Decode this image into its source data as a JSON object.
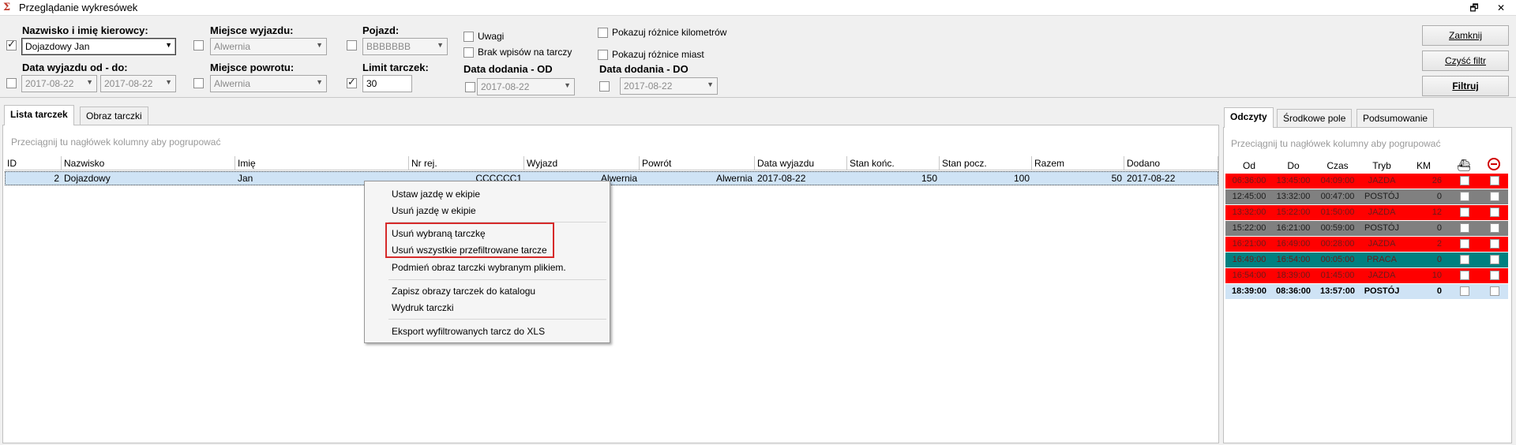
{
  "window": {
    "title": "Przeglądanie wykresówek",
    "app_icon_glyph": "Σ",
    "restore_glyph": "🗗",
    "close_glyph": "✕"
  },
  "filters": {
    "driver_label": "Nazwisko i imię kierowcy:",
    "driver_value": "Dojazdowy Jan",
    "departure_place_label": "Miejsce wyjazdu:",
    "departure_place_value": "Alwernia",
    "vehicle_label": "Pojazd:",
    "vehicle_value": "BBBBBBB",
    "remarks_label": "Uwagi",
    "no_entries_label": "Brak wpisów na tarczy",
    "show_km_diff_label": "Pokazuj różnice kilometrów",
    "show_city_diff_label": "Pokazuj różnice miast",
    "departure_date_label": "Data wyjazdu od - do:",
    "date_from": "2017-08-22",
    "date_to": "2017-08-22",
    "return_place_label": "Miejsce powrotu:",
    "return_place_value": "Alwernia",
    "limit_label": "Limit tarczek:",
    "limit_value": "30",
    "added_from_label": "Data dodania - OD",
    "added_from_value": "2017-08-22",
    "added_to_label": "Data dodania - DO",
    "added_to_value": "2017-08-22"
  },
  "buttons": {
    "close": "Zamknij",
    "clear_filter": "Czyść filtr",
    "filter": "Filtruj"
  },
  "left_tabs": [
    "Lista tarczek",
    "Obraz tarczki"
  ],
  "group_hint": "Przeciągnij tu nagłówek kolumny aby pogrupować",
  "grid": {
    "columns": [
      "ID",
      "Nazwisko",
      "Imię",
      "Nr rej.",
      "Wyjazd",
      "Powrót",
      "Data wyjazdu",
      "Stan końc.",
      "Stan pocz.",
      "Razem",
      "Dodano"
    ],
    "rows": [
      [
        "2",
        "Dojazdowy",
        "Jan",
        "CCCCCC1",
        "Alwernia",
        "Alwernia",
        "2017-08-22",
        "150",
        "100",
        "50",
        "2017-08-22"
      ]
    ]
  },
  "context_menu": {
    "items": [
      "Ustaw jazdę w ekipie",
      "Usuń jazdę w ekipie",
      "Usuń wybraną tarczkę",
      "Usuń wszystkie przefiltrowane tarcze",
      "Podmień obraz tarczki wybranym plikiem.",
      "Zapisz obrazy tarczek do katalogu",
      "Wydruk tarczki",
      "Eksport wyfiltrowanych tarcz do XLS"
    ]
  },
  "right_tabs": [
    "Odczyty",
    "Środkowe pole",
    "Podsumowanie"
  ],
  "readings": {
    "columns": [
      "Od",
      "Do",
      "Czas",
      "Tryb",
      "KM"
    ],
    "icons": [
      "ship-icon",
      "no-entry-icon"
    ],
    "colors": {
      "red": "#ff0000",
      "gray": "#808080",
      "teal": "#008080",
      "summary": "#cfe3f5"
    },
    "rows": [
      {
        "od": "06:36:00",
        "do": "13:45:00",
        "czas": "04:09:00",
        "tryb": "JAZDA",
        "km": "26",
        "color": "red"
      },
      {
        "od": "12:45:00",
        "do": "13:32:00",
        "czas": "00:47:00",
        "tryb": "POSTÓJ",
        "km": "0",
        "color": "gray"
      },
      {
        "od": "13:32:00",
        "do": "15:22:00",
        "czas": "01:50:00",
        "tryb": "JAZDA",
        "km": "12",
        "color": "red"
      },
      {
        "od": "15:22:00",
        "do": "16:21:00",
        "czas": "00:59:00",
        "tryb": "POSTÓJ",
        "km": "0",
        "color": "gray"
      },
      {
        "od": "16:21:00",
        "do": "16:49:00",
        "czas": "00:28:00",
        "tryb": "JAZDA",
        "km": "2",
        "color": "red"
      },
      {
        "od": "16:49:00",
        "do": "16:54:00",
        "czas": "00:05:00",
        "tryb": "PRACA",
        "km": "0",
        "color": "teal"
      },
      {
        "od": "16:54:00",
        "do": "18:39:00",
        "czas": "01:45:00",
        "tryb": "JAZDA",
        "km": "10",
        "color": "red"
      }
    ],
    "summary": {
      "od": "18:39:00",
      "do": "08:36:00",
      "czas": "13:57:00",
      "tryb": "POSTÓJ",
      "km": "0"
    }
  }
}
